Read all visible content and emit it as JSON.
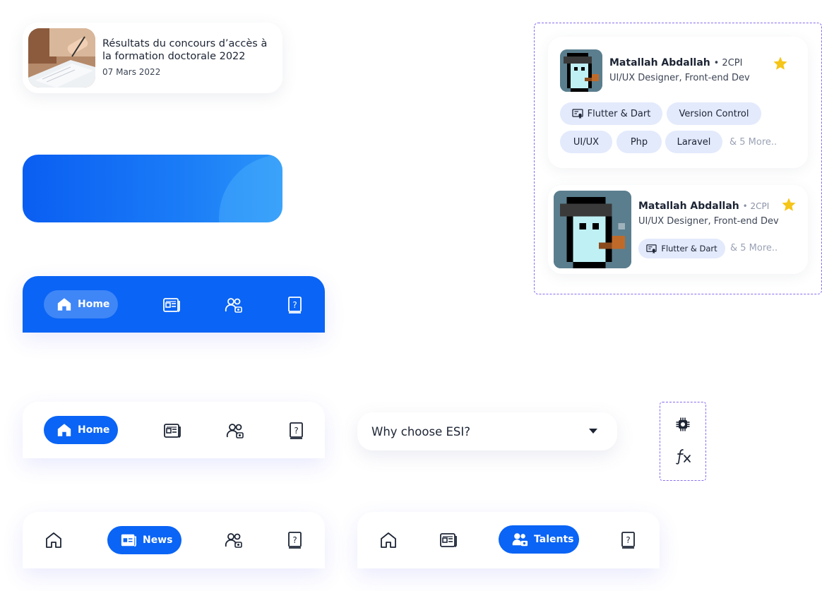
{
  "news_card": {
    "title": "Résultats du concours d’accès à la formation doctorale 2022",
    "date": "07 Mars 2022"
  },
  "navbars": {
    "home_label": "Home",
    "news_label": "News",
    "talents_label": "Talents"
  },
  "accordion": {
    "question": "Why choose ESI?"
  },
  "talent_large": {
    "name": "Matallah Abdallah",
    "level": "• 2CPI",
    "role": "UI/UX Designer, Front-end Dev",
    "skills": [
      "Flutter & Dart",
      "Version Control",
      "UI/UX",
      "Php",
      "Laravel"
    ],
    "more": "& 5 More.."
  },
  "talent_small": {
    "name": "Matallah Abdallah",
    "level": "• 2CPI",
    "role": "UI/UX Designer, Front-end Dev",
    "skill": "Flutter & Dart",
    "more": "& 5 More.."
  },
  "icons": [
    "home-icon",
    "news-icon",
    "talents-icon",
    "help-book-icon",
    "chip-icon",
    "function-icon",
    "star-icon",
    "certificate-icon",
    "caret-down-icon"
  ],
  "colors": {
    "primary": "#0a64f5",
    "chip_bg": "#e3eafc",
    "star": "#f5c518",
    "dashed_frame": "#8a6cf0"
  }
}
